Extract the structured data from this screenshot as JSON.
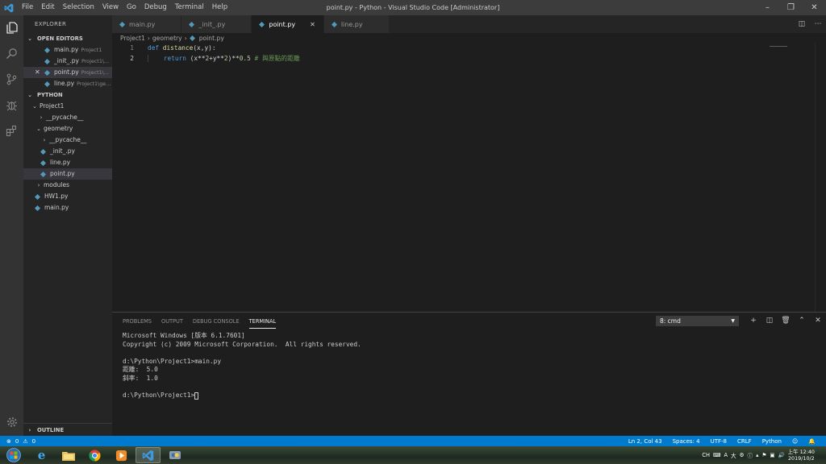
{
  "titlebar": {
    "menu": [
      "File",
      "Edit",
      "Selection",
      "View",
      "Go",
      "Debug",
      "Terminal",
      "Help"
    ],
    "title": "point.py - Python - Visual Studio Code [Administrator]"
  },
  "sidebar": {
    "title": "EXPLORER",
    "open_editors": {
      "header": "OPEN EDITORS",
      "items": [
        {
          "name": "main.py",
          "hint": "Project1"
        },
        {
          "name": "_init_.py",
          "hint": "Project1\\..."
        },
        {
          "name": "point.py",
          "hint": "Project1\\..."
        },
        {
          "name": "line.py",
          "hint": "Project1\\ge..."
        }
      ]
    },
    "workspace": {
      "header": "PYTHON",
      "project": "Project1",
      "pycache": "__pycache__",
      "geometry": "geometry",
      "geo_pycache": "__pycache__",
      "init": "_init_.py",
      "line": "line.py",
      "point": "point.py",
      "modules": "modules",
      "hw1": "HW1.py",
      "main": "main.py"
    },
    "outline": "OUTLINE"
  },
  "tabs": [
    "main.py",
    "_init_.py",
    "point.py",
    "line.py"
  ],
  "breadcrumb": [
    "Project1",
    "geometry",
    "point.py"
  ],
  "code": {
    "line_numbers": [
      "1",
      "2"
    ],
    "l1_kw": "def",
    "l1_fn": "distance",
    "l1_rest": "(x,y):",
    "l2_kw": "return",
    "l2_a": " (x**",
    "l2_n1": "2",
    "l2_b": "+y**",
    "l2_n2": "2",
    "l2_c": ")**",
    "l2_n3": "0.5",
    "l2_comment": " # 與原點的距離"
  },
  "panel": {
    "tabs": [
      "PROBLEMS",
      "OUTPUT",
      "DEBUG CONSOLE",
      "TERMINAL"
    ],
    "terminal_select": "8: cmd",
    "lines": [
      "Microsoft Windows [版本 6.1.7601]",
      "Copyright (c) 2009 Microsoft Corporation.  All rights reserved.",
      "",
      "d:\\Python\\Project1>main.py",
      "距離:  5.0",
      "斜率:  1.0",
      "",
      "d:\\Python\\Project1>"
    ]
  },
  "status": {
    "errors": "0",
    "warnings": "0",
    "position": "Ln 2, Col 43",
    "spaces": "Spaces: 4",
    "encoding": "UTF-8",
    "eol": "CRLF",
    "language": "Python"
  },
  "tray": {
    "ime": "CH",
    "time": "上午 12:40",
    "date": "2019/10/2"
  },
  "colors": {
    "accent": "#007acc",
    "python_icon": "#519aba"
  }
}
